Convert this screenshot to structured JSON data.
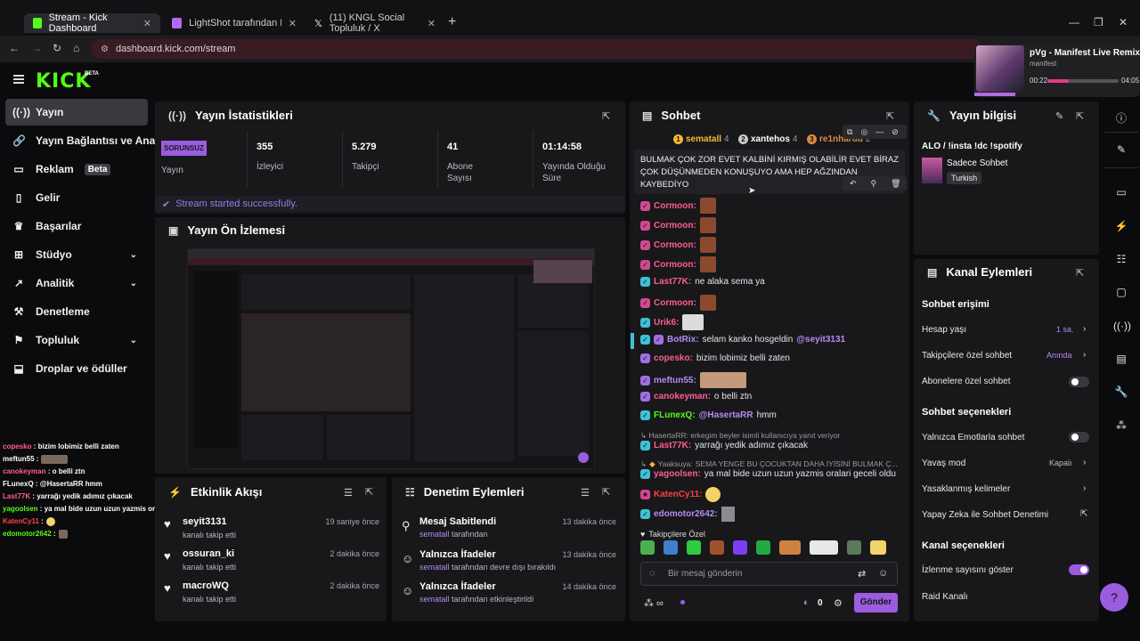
{
  "browser": {
    "tabs": [
      {
        "title": "Stream - Kick Dashboard",
        "favicon_color": "#53fc18"
      },
      {
        "title": "LightShot tarafından Ekran Görü",
        "favicon_color": "#b468f5"
      },
      {
        "title": "(11) KNGL Social Topluluk / X",
        "favicon_color": "#e8e8e8"
      }
    ],
    "url": "dashboard.kick.com/stream",
    "new_tab": "+",
    "window_controls": [
      "—",
      "❐",
      "✕"
    ]
  },
  "mini_player": {
    "title": "pVg - Manifest Live Remix",
    "subtitle": "manifest",
    "current_time": "00:22",
    "total_time": "04:05",
    "progress": 0.3
  },
  "app": {
    "logo": "KICK",
    "logo_badge": "BETA"
  },
  "sidebar": {
    "items": [
      {
        "label": "Yayın",
        "icon": "broadcast-icon",
        "glyph": "((·))",
        "selected": true
      },
      {
        "label": "Yayın Bağlantısı ve Anahtar",
        "icon": "link-icon",
        "glyph": "🔗"
      },
      {
        "label": "Reklam",
        "icon": "ad-icon",
        "glyph": "▭",
        "badge": "Beta"
      },
      {
        "label": "Gelir",
        "icon": "revenue-icon",
        "glyph": "▯"
      },
      {
        "label": "Başarılar",
        "icon": "trophy-icon",
        "glyph": "♛"
      },
      {
        "label": "Stüdyo",
        "icon": "studio-icon",
        "glyph": "⊞",
        "expandable": true
      },
      {
        "label": "Analitik",
        "icon": "analytics-icon",
        "glyph": "↗",
        "expandable": true
      },
      {
        "label": "Denetleme",
        "icon": "moderation-icon",
        "glyph": "⚒"
      },
      {
        "label": "Topluluk",
        "icon": "community-icon",
        "glyph": "⚑",
        "expandable": true
      },
      {
        "label": "Droplar ve ödüller",
        "icon": "drops-icon",
        "glyph": "⬓"
      }
    ]
  },
  "overlay_chat": [
    {
      "user": "copesko",
      "color": "#ff5d8f",
      "text": " : bizim lobimiz belli zaten"
    },
    {
      "user": "meftun55",
      "color": "#ffffff",
      "text": " :",
      "emote": true
    },
    {
      "user": "canokeyman",
      "color": "#ff5d8f",
      "text": " : o belli ztn"
    },
    {
      "user": "FLunexQ",
      "color": "#ffffff",
      "text": " : @HasertaRR hmm",
      "mention": "@HasertaRR"
    },
    {
      "user": "Last77K",
      "color": "#ff5d8f",
      "text": " : yarrağı yedik adımız çıkacak"
    },
    {
      "user": "yagoolsen",
      "color": "#53fc18",
      "text": " : ya mal bide uzun uzun yazmis oralari geceli oldu"
    },
    {
      "user": "KatenCy11",
      "color": "#ff4040",
      "text": " :",
      "emote": true
    },
    {
      "user": "edomotor2642",
      "color": "#53fc18",
      "text": " :",
      "emote": true
    }
  ],
  "stats_panel": {
    "title": "Yayın İstatistikleri",
    "badge": "SORUNSUZ",
    "stats": [
      {
        "value": "",
        "label": "Yayın"
      },
      {
        "value": "355",
        "label": "İzleyici"
      },
      {
        "value": "5.279",
        "label": "Takipçi"
      },
      {
        "value": "41",
        "label": "Abone Sayısı"
      },
      {
        "value": "01:14:58",
        "label": "Yayında Olduğu Süre"
      }
    ],
    "success_msg": "Stream started successfully."
  },
  "preview_panel": {
    "title": "Yayın Ön İzlemesi"
  },
  "activity_panel": {
    "title": "Etkinlik Akışı",
    "items": [
      {
        "user": "seyit3131",
        "action": "kanalı takip etti",
        "time": "19 saniye önce"
      },
      {
        "user": "ossuran_ki",
        "action": "kanalı takip etti",
        "time": "2 dakika önce"
      },
      {
        "user": "macroWQ",
        "action": "kanalı takip etti",
        "time": "2 dakika önce"
      }
    ]
  },
  "moderation_panel": {
    "title": "Denetim Eylemleri",
    "items": [
      {
        "title": "Mesaj Sabitlendi",
        "user": "sematall",
        "rest": " tarafından",
        "time": "13 dakika önce",
        "icon": "pin-icon"
      },
      {
        "title": "Yalnızca İfadeler",
        "user": "sematall",
        "rest": " tarafından devre dışı bırakıldı",
        "time": "13 dakika önce",
        "icon": "smile-icon"
      },
      {
        "title": "Yalnızca İfadeler",
        "user": "sematall",
        "rest": " tarafından etkinleştirildi",
        "time": "14 dakika önce",
        "icon": "smile-icon"
      }
    ]
  },
  "chat": {
    "title": "Sohbet",
    "top_gifters": [
      {
        "rank": "1",
        "name": "sematall",
        "count": "4",
        "color": "#f5b82e"
      },
      {
        "rank": "2",
        "name": "xantehos",
        "count": "4",
        "color": "#c9c9c9"
      },
      {
        "rank": "3",
        "name": "re1nhardd",
        "count": "2",
        "color": "#d98b45"
      }
    ],
    "pinned": "BULMAK ÇOK ZOR EVET KALBİNİ KIRMIŞ OLABİLİR EVET BİRAZ ÇOK DÜŞÜNMEDEN KONUŞUYO AMA HEP AĞZINDAN KAYBEDİYO",
    "messages": [
      {
        "user": "Cormoon:",
        "color": "#ff5d8f",
        "text": "",
        "emote": true,
        "badge": "#d04a8f"
      },
      {
        "user": "Cormoon:",
        "color": "#ff5d8f",
        "text": "",
        "emote": true,
        "badge": "#d04a8f"
      },
      {
        "user": "Cormoon:",
        "color": "#ff5d8f",
        "text": "",
        "emote": true,
        "badge": "#d04a8f"
      },
      {
        "user": "Cormoon:",
        "color": "#ff5d8f",
        "text": "",
        "emote": true,
        "badge": "#d04a8f"
      },
      {
        "user": "Last77K:",
        "color": "#ff5d8f",
        "text": "ne alaka sema ya",
        "badge": "#3fc1d6"
      },
      {
        "user": "Cormoon:",
        "color": "#ff5d8f",
        "text": "",
        "emote": true,
        "badge": "#d04a8f"
      },
      {
        "user": "Urik6:",
        "color": "#ff5d8f",
        "text": "",
        "emote": true,
        "badge": "#3fc1d6"
      },
      {
        "user": "BotRix:",
        "color": "#b28cf0",
        "text": "selam kanko hosgeldin",
        "mention": "@seyit3131",
        "badge": "#3fc1d6",
        "highlight": true
      },
      {
        "user": "copesko:",
        "color": "#ff5d8f",
        "text": "bizim lobimiz belli zaten",
        "badge": "#a070e0"
      },
      {
        "user": "meftun55:",
        "color": "#b28cf0",
        "text": "",
        "emote": true,
        "badge": "#a070e0"
      },
      {
        "user": "canokeyman:",
        "color": "#ff5d8f",
        "text": "o belli ztn",
        "badge": "#a070e0"
      },
      {
        "user": "FLunexQ:",
        "color": "#53fc18",
        "text": "hmm",
        "mention": "@HasertaRR",
        "badge": "#3fc1d6"
      }
    ],
    "reply1": "↳ HasertaRR: erkegim beyler isimli kullanıcıya yanıt veriyor",
    "msg_last": {
      "user": "Last77K:",
      "color": "#ff5d8f",
      "text": "yarrağı yedik adımız çıkacak"
    },
    "reply2_user": "Yaaksuya:",
    "reply2": "SEMA YENGE BU ÇOCUKTAN DAHA İYİSİNİ BULMAK Ç...",
    "msg_yago": {
      "user": "yagoolsen:",
      "color": "#ff5d8f",
      "text": "ya mal bide uzun uzun yazmis oralari geceli oldu"
    },
    "msg_katen": {
      "user": "KatenCy11:",
      "color": "#ff4040"
    },
    "msg_edo": {
      "user": "edomotor2642:",
      "color": "#b28cf0"
    },
    "followers_only": "Takipçilere Özel",
    "input_placeholder": "Bir mesaj gönderin",
    "points": "0",
    "send": "Gönder"
  },
  "stream_info": {
    "title_label": "Yayın bilgisi",
    "stream_title": "ALO / !insta !dc !spotify",
    "category": "Sadece Sohbet",
    "tag": "Turkish"
  },
  "channel_actions": {
    "title": "Kanal Eylemleri",
    "chat_access": "Sohbet erişimi",
    "account_age": {
      "label": "Hesap yaşı",
      "value": "1 sa."
    },
    "followers_chat": {
      "label": "Takipçilere özel sohbet",
      "value": "Anında"
    },
    "subs_chat": {
      "label": "Abonelere özel sohbet",
      "on": false
    },
    "chat_options": "Sohbet seçenekleri",
    "emote_only": {
      "label": "Yalnızca Emotlarla sohbet",
      "on": false
    },
    "slow_mode": {
      "label": "Yavaş mod",
      "value": "Kapalı"
    },
    "banned_words": "Yasaklanmış kelimeler",
    "ai_moderation": "Yapay Zeka ile Sohbet Denetimi",
    "channel_options": "Kanal seçenekleri",
    "viewer_count": {
      "label": "İzlenme sayısını göster",
      "on": true
    },
    "raid": "Raid Kanalı"
  },
  "colors": {
    "accent": "#53fc18",
    "purple": "#9b5ce0",
    "panel": "#18181b",
    "bg": "#0b0b0d"
  }
}
